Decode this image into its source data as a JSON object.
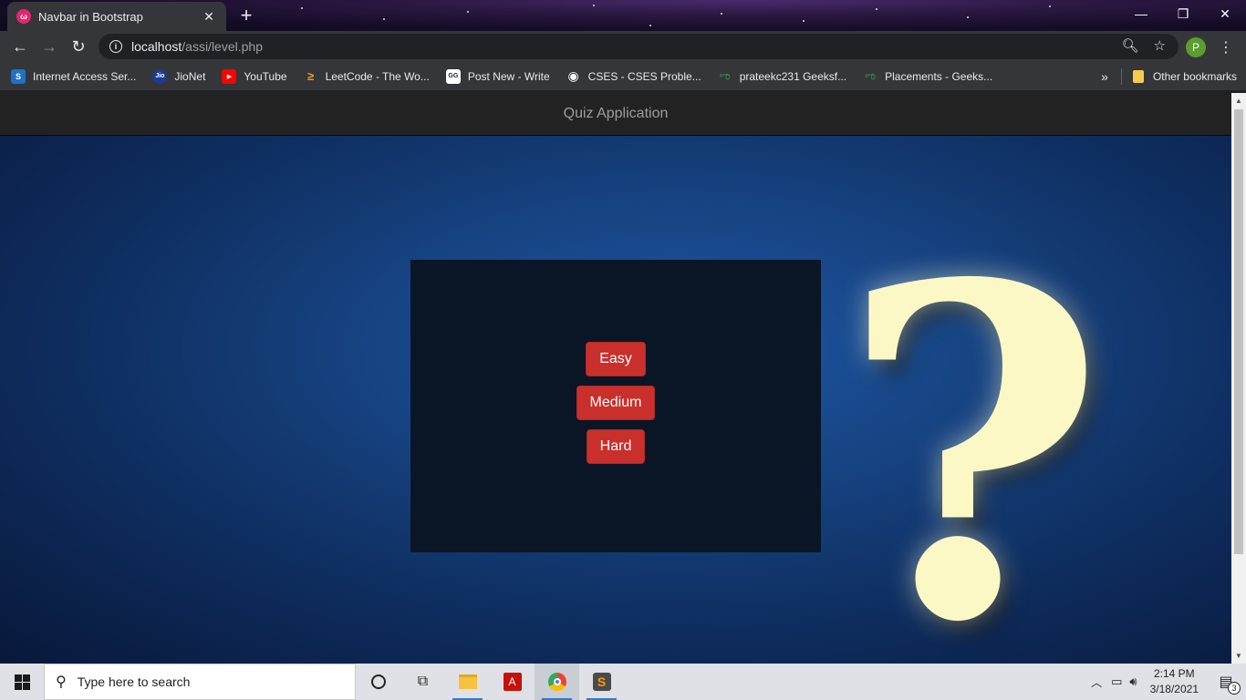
{
  "browser": {
    "tab": {
      "title": "Navbar in Bootstrap",
      "favicon": "bootstrap-icon"
    },
    "url": {
      "host": "localhost",
      "path": "/assi/level.php"
    },
    "profile_initial": "P",
    "window_controls": [
      "minimize-icon",
      "restore-icon",
      "close-icon"
    ]
  },
  "bookmarks": [
    {
      "label": "Internet Access Ser...",
      "icon": "S"
    },
    {
      "label": "JioNet",
      "icon": "Jio"
    },
    {
      "label": "YouTube",
      "icon": "▶"
    },
    {
      "label": "LeetCode - The Wo...",
      "icon": "≥"
    },
    {
      "label": "Post New - Write",
      "icon": "GG"
    },
    {
      "label": "CSES - CSES Proble...",
      "icon": "◉"
    },
    {
      "label": "prateekc231 Geeksf...",
      "icon": "ಌ"
    },
    {
      "label": "Placements - Geeks...",
      "icon": "ಌ"
    }
  ],
  "bookmarks_overflow": "»",
  "other_bookmarks": "Other bookmarks",
  "page": {
    "navbar_brand": "Quiz Application",
    "levels": [
      "Easy",
      "Medium",
      "Hard"
    ]
  },
  "taskbar": {
    "search_placeholder": "Type here to search",
    "time": "2:14 PM",
    "date": "3/18/2021",
    "notifications": "3"
  },
  "colors": {
    "level_button": "#c9302c",
    "navbar": "#222222",
    "panel": "#0a1526"
  }
}
